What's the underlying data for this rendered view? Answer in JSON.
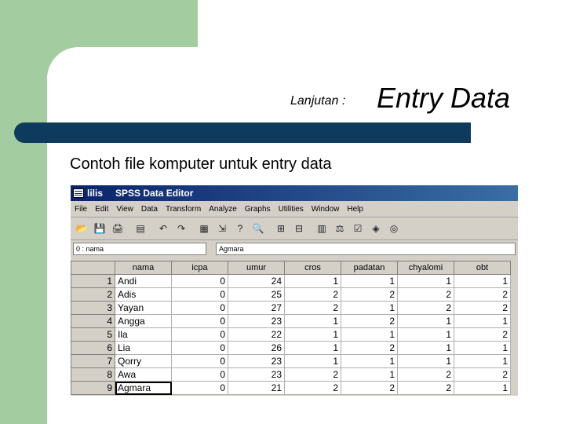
{
  "slide": {
    "subtitle": "Lanjutan :",
    "title": "Entry Data",
    "caption": "Contoh file komputer untuk entry data"
  },
  "spss": {
    "file_name": "lilis",
    "app_title": "SPSS Data Editor",
    "menu": [
      "File",
      "Edit",
      "View",
      "Data",
      "Transform",
      "Analyze",
      "Graphs",
      "Utilities",
      "Window",
      "Help"
    ],
    "toolbar_icons": [
      {
        "name": "open-icon",
        "glyph": "📂"
      },
      {
        "name": "save-icon",
        "glyph": "💾"
      },
      {
        "name": "print-icon",
        "glyph": "🖨"
      },
      {
        "name": "dialog-recall-icon",
        "glyph": "▤"
      },
      {
        "name": "undo-icon",
        "glyph": "↶"
      },
      {
        "name": "redo-icon",
        "glyph": "↷"
      },
      {
        "name": "goto-chart-icon",
        "glyph": "▦"
      },
      {
        "name": "goto-case-icon",
        "glyph": "⇲"
      },
      {
        "name": "variables-icon",
        "glyph": "?"
      },
      {
        "name": "find-icon",
        "glyph": "🔍"
      },
      {
        "name": "insert-case-icon",
        "glyph": "⊞"
      },
      {
        "name": "insert-variable-icon",
        "glyph": "⊟"
      },
      {
        "name": "split-file-icon",
        "glyph": "▥"
      },
      {
        "name": "weight-cases-icon",
        "glyph": "⚖"
      },
      {
        "name": "select-cases-icon",
        "glyph": "☑"
      },
      {
        "name": "value-labels-icon",
        "glyph": "◈"
      },
      {
        "name": "use-sets-icon",
        "glyph": "◎"
      }
    ],
    "cell_ref": "0 : nama",
    "cell_value": "Agmara",
    "columns": [
      "nama",
      "icpa",
      "umur",
      "cros",
      "padatan",
      "chyalomi",
      "obt"
    ],
    "rows": [
      [
        "1",
        "Andi",
        "0",
        "24",
        "1",
        "1",
        "1",
        "1"
      ],
      [
        "2",
        "Adis",
        "0",
        "25",
        "2",
        "2",
        "2",
        "2"
      ],
      [
        "3",
        "Yayan",
        "0",
        "27",
        "2",
        "1",
        "2",
        "2"
      ],
      [
        "4",
        "Angga",
        "0",
        "23",
        "1",
        "2",
        "1",
        "1"
      ],
      [
        "5",
        "Ila",
        "0",
        "22",
        "1",
        "1",
        "1",
        "2"
      ],
      [
        "6",
        "Lia",
        "0",
        "26",
        "1",
        "2",
        "1",
        "1"
      ],
      [
        "7",
        "Qorry",
        "0",
        "23",
        "1",
        "1",
        "1",
        "1"
      ],
      [
        "8",
        "Awa",
        "0",
        "23",
        "2",
        "1",
        "2",
        "2"
      ],
      [
        "9",
        "Agmara",
        "0",
        "21",
        "2",
        "2",
        "2",
        "1"
      ]
    ],
    "active_cell": {
      "row": 9,
      "column": "nama"
    }
  }
}
